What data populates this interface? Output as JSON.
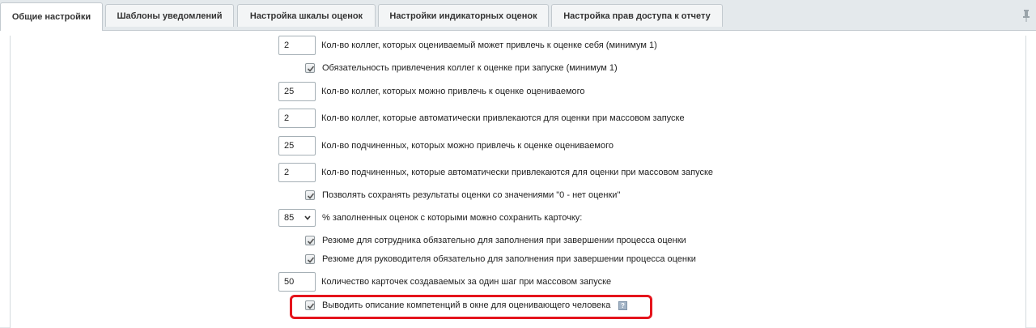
{
  "tabs": [
    {
      "label": "Общие настройки",
      "active": true
    },
    {
      "label": "Шаблоны уведомлений",
      "active": false
    },
    {
      "label": "Настройка шкалы оценок",
      "active": false
    },
    {
      "label": "Настройки индикаторных оценок",
      "active": false
    },
    {
      "label": "Настройка прав доступа к отчету",
      "active": false
    }
  ],
  "settings": {
    "colleagues_self": {
      "value": "2",
      "label": "Кол-во коллег, которых оцениваемый может привлечь к оценке себя (минимум 1)"
    },
    "colleagues_required": {
      "checked": true,
      "label": "Обязательность привлечения коллег к оценке при запуске (минимум 1)"
    },
    "colleagues_assess": {
      "value": "25",
      "label": "Кол-во коллег, которых можно привлечь к оценке оцениваемого"
    },
    "colleagues_auto": {
      "value": "2",
      "label": "Кол-во коллег, которые автоматически привлекаются для оценки при массовом запуске"
    },
    "subordinates_assess": {
      "value": "25",
      "label": "Кол-во подчиненных, которых можно привлечь к оценке оцениваемого"
    },
    "subordinates_auto": {
      "value": "2",
      "label": "Кол-во подчиненных, которые автоматически привлекаются для оценки при массовом запуске"
    },
    "allow_zero": {
      "checked": true,
      "label": "Позволять сохранять результаты оценки со значениями \"0 - нет оценки\""
    },
    "filled_percent": {
      "value": "85",
      "label": "% заполненных оценок с которыми можно сохранить карточку:"
    },
    "resume_employee": {
      "checked": true,
      "label": "Резюме для сотрудника обязательно для заполнения при завершении процесса оценки"
    },
    "resume_manager": {
      "checked": true,
      "label": "Резюме для руководителя обязательно для заполнения при завершении процесса оценки"
    },
    "cards_per_step": {
      "value": "50",
      "label": "Количество карточек создаваемых за один шаг при массовом запуске"
    },
    "show_competency": {
      "checked": true,
      "label": "Выводить описание компетенций в окне для оценивающего человека",
      "help": "?"
    }
  },
  "icons": {
    "pin": "pin-icon",
    "help": "help-icon",
    "check": "check-icon",
    "dropdown": "chevron-down-icon"
  },
  "colors": {
    "highlight": "#e5141c",
    "background": "#e4e9ec"
  }
}
